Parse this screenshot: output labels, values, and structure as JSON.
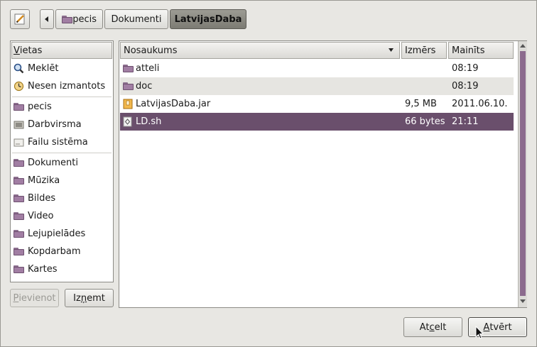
{
  "toolbar": {
    "edit_icon": "pencil-icon",
    "back_icon": "chevron-left-icon",
    "crumbs": [
      "pecis",
      "Dokumenti",
      "LatvijasDaba"
    ]
  },
  "sidebar": {
    "header_first": "V",
    "header_rest": "ietas",
    "items": [
      {
        "label": "Meklēt",
        "icon": "search-icon"
      },
      {
        "label": "Nesen izmantots",
        "icon": "recent-icon"
      },
      {
        "label": "pecis",
        "icon": "folder-icon"
      },
      {
        "label": "Darbvirsma",
        "icon": "desktop-icon"
      },
      {
        "label": "Failu sistēma",
        "icon": "drive-icon"
      },
      {
        "label": "Dokumenti",
        "icon": "folder-icon"
      },
      {
        "label": "Mūzika",
        "icon": "folder-icon"
      },
      {
        "label": "Bildes",
        "icon": "folder-icon"
      },
      {
        "label": "Video",
        "icon": "folder-icon"
      },
      {
        "label": "Lejupielādes",
        "icon": "folder-icon"
      },
      {
        "label": "Kopdarbam",
        "icon": "folder-icon"
      },
      {
        "label": "Kartes",
        "icon": "folder-icon"
      }
    ],
    "add_first": "P",
    "add_rest": "ievienot",
    "remove_a": "Iz",
    "remove_u": "ņ",
    "remove_b": "emt"
  },
  "filelist": {
    "col_name": "Nosaukums",
    "col_size": "Izmērs",
    "col_modified": "Mainīts",
    "rows": [
      {
        "name": "atteli",
        "size": "",
        "modified": "08:19",
        "icon": "folder-icon"
      },
      {
        "name": "doc",
        "size": "",
        "modified": "08:19",
        "icon": "folder-icon"
      },
      {
        "name": "LatvijasDaba.jar",
        "size": "9,5 MB",
        "modified": "2011.06.10.",
        "icon": "archive-icon"
      },
      {
        "name": "LD.sh",
        "size": "66 bytes",
        "modified": "21:11",
        "icon": "script-icon"
      }
    ]
  },
  "buttons": {
    "cancel_a": "At",
    "cancel_u": "c",
    "cancel_b": "elt",
    "open_first": "A",
    "open_rest": "tvērt"
  },
  "colors": {
    "selection": "#6a4f6c",
    "folder": "#a17ea3"
  }
}
